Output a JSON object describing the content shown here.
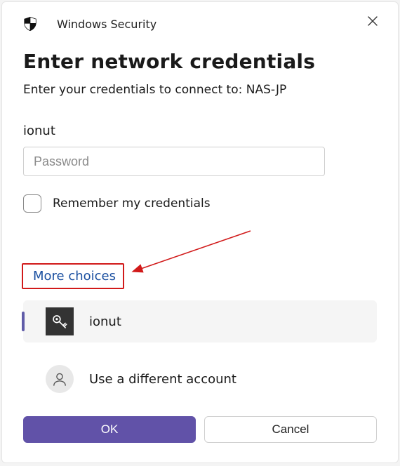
{
  "app_title": "Windows Security",
  "heading": "Enter network credentials",
  "subtitle": "Enter your credentials to connect to: NAS-JP",
  "username": "ionut",
  "password_placeholder": "Password",
  "remember_label": "Remember my credentials",
  "more_choices_label": "More choices",
  "accounts": [
    {
      "label": "ionut",
      "icon": "key-icon",
      "selected": true
    },
    {
      "label": "Use a different account",
      "icon": "person-icon",
      "selected": false
    }
  ],
  "buttons": {
    "ok": "OK",
    "cancel": "Cancel"
  },
  "colors": {
    "accent": "#6152a8",
    "highlight_red": "#d11a1a",
    "link_blue": "#1a4fa0"
  }
}
